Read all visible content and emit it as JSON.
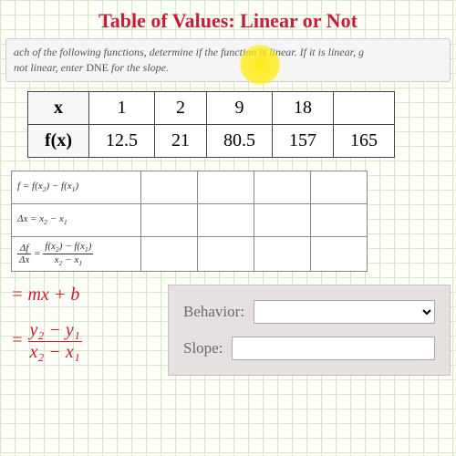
{
  "title": "Table of Values: Linear or Not",
  "prompt": {
    "line1": "ach of the following functions, determine if the function is linear. If it is linear, g",
    "line2_a": " not linear, enter ",
    "line2_b": "DNE",
    "line2_c": " for the slope."
  },
  "table": {
    "row_labels": [
      "x",
      "f(x)"
    ],
    "x": [
      "1",
      "2",
      "9",
      "18",
      ""
    ],
    "fx": [
      "12.5",
      "21",
      "80.5",
      "157",
      "165"
    ]
  },
  "calc_labels": {
    "r1": "f = f(x₂) − f(x₁)",
    "r2": "Δx = x₂ − x₁",
    "r3_left_num": "Δf",
    "r3_left_den": "Δx",
    "r3_eq": "=",
    "r3_right_num": "f(x₂) − f(x₁)",
    "r3_right_den": "x₂ − x₁"
  },
  "formulas": {
    "linear": "= mx + b",
    "slope_num": "y₂ − y₁",
    "slope_den": "x₂ − x₁",
    "eq": "="
  },
  "panel": {
    "behavior_label": "Behavior:",
    "slope_label": "Slope:",
    "behavior_value": "",
    "slope_value": ""
  }
}
